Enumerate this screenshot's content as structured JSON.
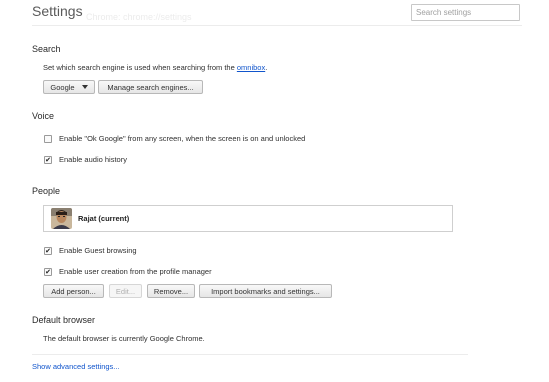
{
  "header": {
    "title": "Settings",
    "ghost_text": "Chrome: chrome://settings",
    "search_placeholder": "Search settings"
  },
  "search": {
    "heading": "Search",
    "description_prefix": "Set which search engine is used when searching from the ",
    "description_link": "omnibox",
    "description_suffix": ".",
    "engine_selected": "Google",
    "manage_button": "Manage search engines..."
  },
  "voice": {
    "heading": "Voice",
    "ok_google": {
      "label": "Enable \"Ok Google\" from any screen, when the screen is on and unlocked",
      "checked": false
    },
    "audio_history": {
      "label": "Enable audio history",
      "checked": true
    }
  },
  "people": {
    "heading": "People",
    "profiles": [
      {
        "name": "Rajat (current)"
      }
    ],
    "guest_browsing": {
      "label": "Enable Guest browsing",
      "checked": true
    },
    "user_creation": {
      "label": "Enable user creation from the profile manager",
      "checked": true
    },
    "buttons": {
      "add": "Add person...",
      "edit": "Edit...",
      "remove": "Remove...",
      "import": "Import bookmarks and settings..."
    }
  },
  "default_browser": {
    "heading": "Default browser",
    "status": "The default browser is currently Google Chrome."
  },
  "footer": {
    "advanced_link": "Show advanced settings..."
  },
  "colors": {
    "link": "#1155cc",
    "text": "#303030",
    "border": "#cfcfcf"
  }
}
